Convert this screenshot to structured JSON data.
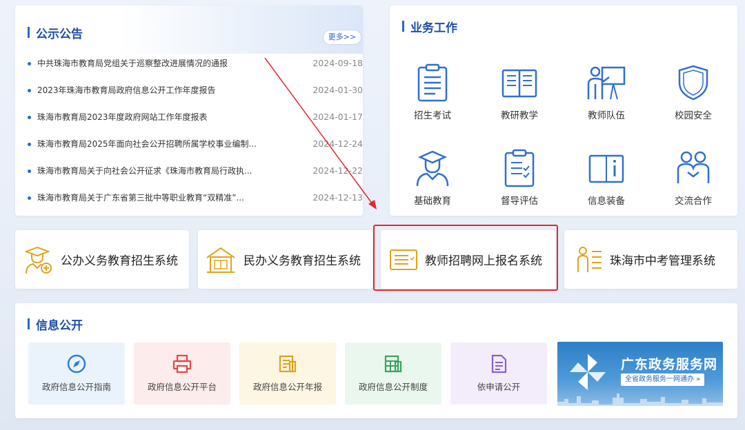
{
  "notice": {
    "title": "公示公告",
    "more": "更多>>",
    "items": [
      {
        "title": "中共珠海市教育局党组关于巡察整改进展情况的通报",
        "date": "2024-09-18"
      },
      {
        "title": "2023年珠海市教育局政府信息公开工作年度报告",
        "date": "2024-01-30"
      },
      {
        "title": "珠海市教育局2023年度政府网站工作年度报表",
        "date": "2024-01-17"
      },
      {
        "title": "珠海市教育局2025年面向社会公开招聘所属学校事业编制...",
        "date": "2024-12-24"
      },
      {
        "title": "珠海市教育局关于向社会公开征求《珠海市教育局行政执...",
        "date": "2024-12-22"
      },
      {
        "title": "珠海市教育局关于广东省第三批中等职业教育“双精准”...",
        "date": "2024-12-13"
      }
    ]
  },
  "business": {
    "title": "业务工作",
    "items": [
      {
        "label": "招生考试",
        "icon": "clipboard-icon"
      },
      {
        "label": "教研教学",
        "icon": "open-book-icon"
      },
      {
        "label": "教师队伍",
        "icon": "teacher-icon"
      },
      {
        "label": "校园安全",
        "icon": "shield-icon"
      },
      {
        "label": "基础教育",
        "icon": "student-icon"
      },
      {
        "label": "督导评估",
        "icon": "checklist-icon"
      },
      {
        "label": "信息装备",
        "icon": "info-book-icon"
      },
      {
        "label": "交流合作",
        "icon": "people-icon"
      }
    ]
  },
  "systems": [
    {
      "label": "公办义务教育招生系统",
      "icon": "graduate-icon"
    },
    {
      "label": "民办义务教育招生系统",
      "icon": "school-house-icon"
    },
    {
      "label": "教师招聘网上报名系统",
      "icon": "list-form-icon"
    },
    {
      "label": "珠海市中考管理系统",
      "icon": "exam-person-icon"
    }
  ],
  "info": {
    "title": "信息公开",
    "cards": [
      {
        "label": "政府信息公开指南",
        "icon": "compass-icon",
        "bg": "#eaf3fc",
        "color": "#2c7fd8"
      },
      {
        "label": "政府信息公开平台",
        "icon": "printer-icon",
        "bg": "#fcecec",
        "color": "#e04848"
      },
      {
        "label": "政府信息公开年报",
        "icon": "report-icon",
        "bg": "#fcf6e3",
        "color": "#e0a21a"
      },
      {
        "label": "政府信息公开制度",
        "icon": "table-icon",
        "bg": "#eaf7ee",
        "color": "#35a55a"
      },
      {
        "label": "依申请公开",
        "icon": "document-icon",
        "bg": "#f3edfb",
        "color": "#8a5cd8"
      }
    ],
    "banner": {
      "title": "广东政务服务网",
      "subtitle": "全省政务服务一网通办 »"
    }
  },
  "colors": {
    "accent": "#2667d6",
    "highlight": "#e4262d",
    "icon": "#2f6fd0"
  }
}
